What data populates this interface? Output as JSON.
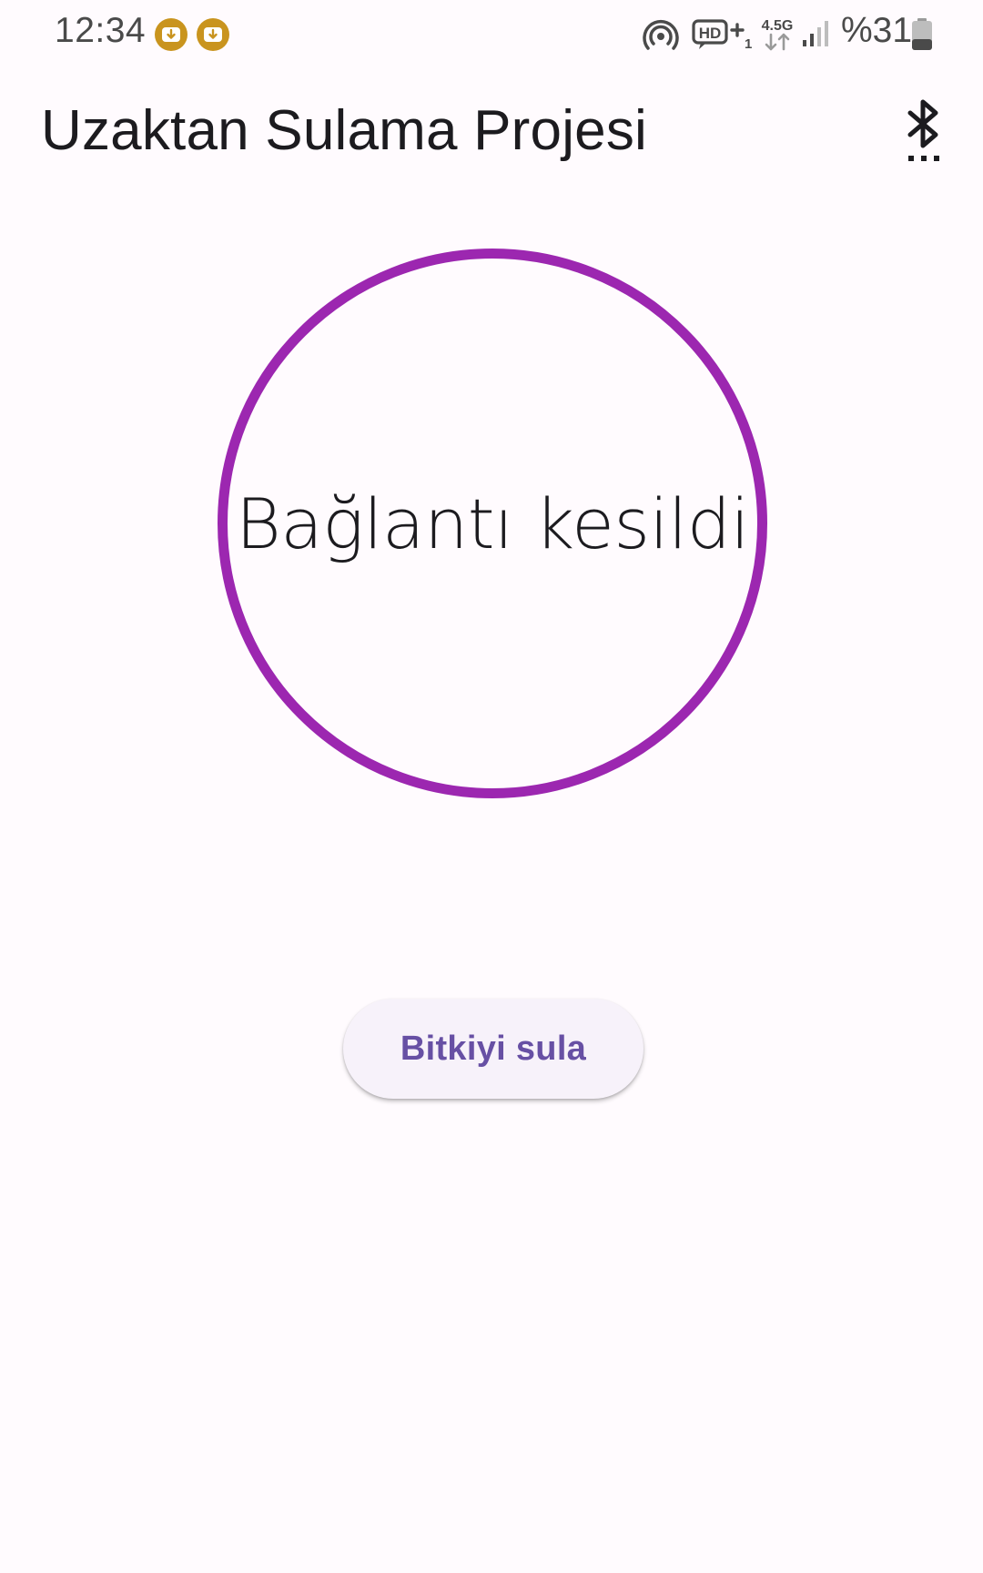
{
  "status_bar": {
    "time": "12:34",
    "notifications": [
      "download-notification-icon",
      "download-notification-icon"
    ],
    "battery": "%31",
    "network_label": "4.5G",
    "icons": [
      "hotspot-icon",
      "hd-voice-icon",
      "network-4-5g-icon",
      "signal-icon",
      "battery-icon"
    ]
  },
  "app_bar": {
    "title": "Uzaktan Sulama Projesi",
    "action_icon": "bluetooth-searching-icon"
  },
  "main": {
    "connection_status": "Bağlantı kesildi",
    "water_button_label": "Bitkiyi sula"
  },
  "colors": {
    "accent": "#9C27B0",
    "button_text": "#6750A4",
    "button_bg": "#F7F2FA",
    "background": "#FFFBFE",
    "notification_badge": "#C9941E"
  }
}
